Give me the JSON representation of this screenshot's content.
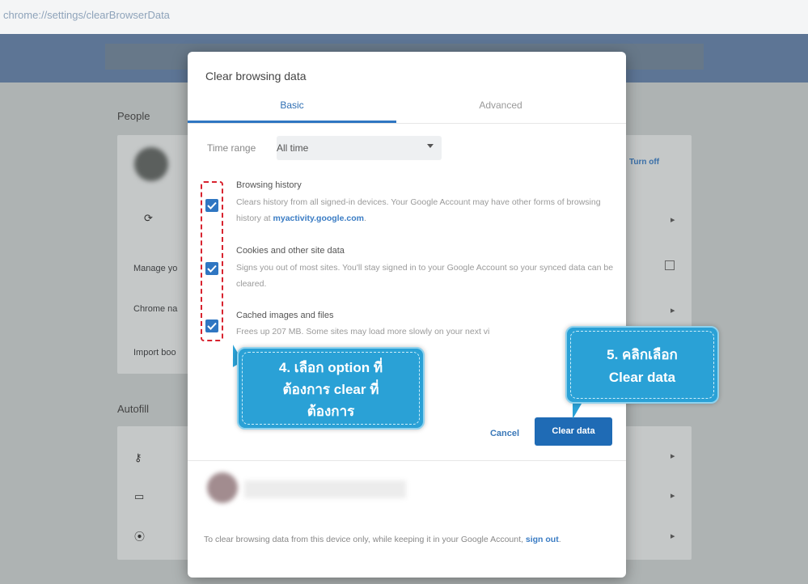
{
  "address_bar": {
    "url": "chrome://settings/clearBrowserData"
  },
  "background": {
    "people_section": "People",
    "turn_off": "Turn off",
    "rows": [
      "Manage yo",
      "Chrome na",
      "Import boo"
    ],
    "autofill_section": "Autofill",
    "sync_icon": "sync-icon",
    "key_icon": "key-icon",
    "card_icon": "credit-card-icon",
    "pin_icon": "location-pin-icon"
  },
  "dialog": {
    "title": "Clear browsing data",
    "tabs": [
      {
        "label": "Basic",
        "selected": true
      },
      {
        "label": "Advanced",
        "selected": false
      }
    ],
    "time_range": {
      "label": "Time range",
      "value": "All time"
    },
    "options": [
      {
        "title": "Browsing history",
        "checked": true,
        "desc": "Clears history from all signed-in devices. Your Google Account may have other forms of browsing history at ",
        "link": "myactivity.google.com",
        "desc_end": "."
      },
      {
        "title": "Cookies and other site data",
        "checked": true,
        "desc": "Signs you out of most sites. You'll stay signed in to your Google Account so your synced data can be cleared."
      },
      {
        "title": "Cached images and files",
        "checked": true,
        "desc": "Frees up 207 MB. Some sites may load more slowly on your next vi"
      }
    ],
    "cancel_label": "Cancel",
    "clear_label": "Clear data",
    "footer": {
      "text": "To clear browsing data from this device only, while keeping it in your Google Account, ",
      "link": "sign out",
      "end": "."
    }
  },
  "callouts": {
    "step4": [
      "4. เลือก option ที่",
      "ต้องการ clear ที่",
      "ต้องการ"
    ],
    "step5": [
      "5. คลิกเลือก",
      "Clear data"
    ]
  },
  "colors": {
    "accent": "#2f76c2",
    "callout": "#2aa1d6",
    "dashed_highlight": "#d8232f"
  }
}
